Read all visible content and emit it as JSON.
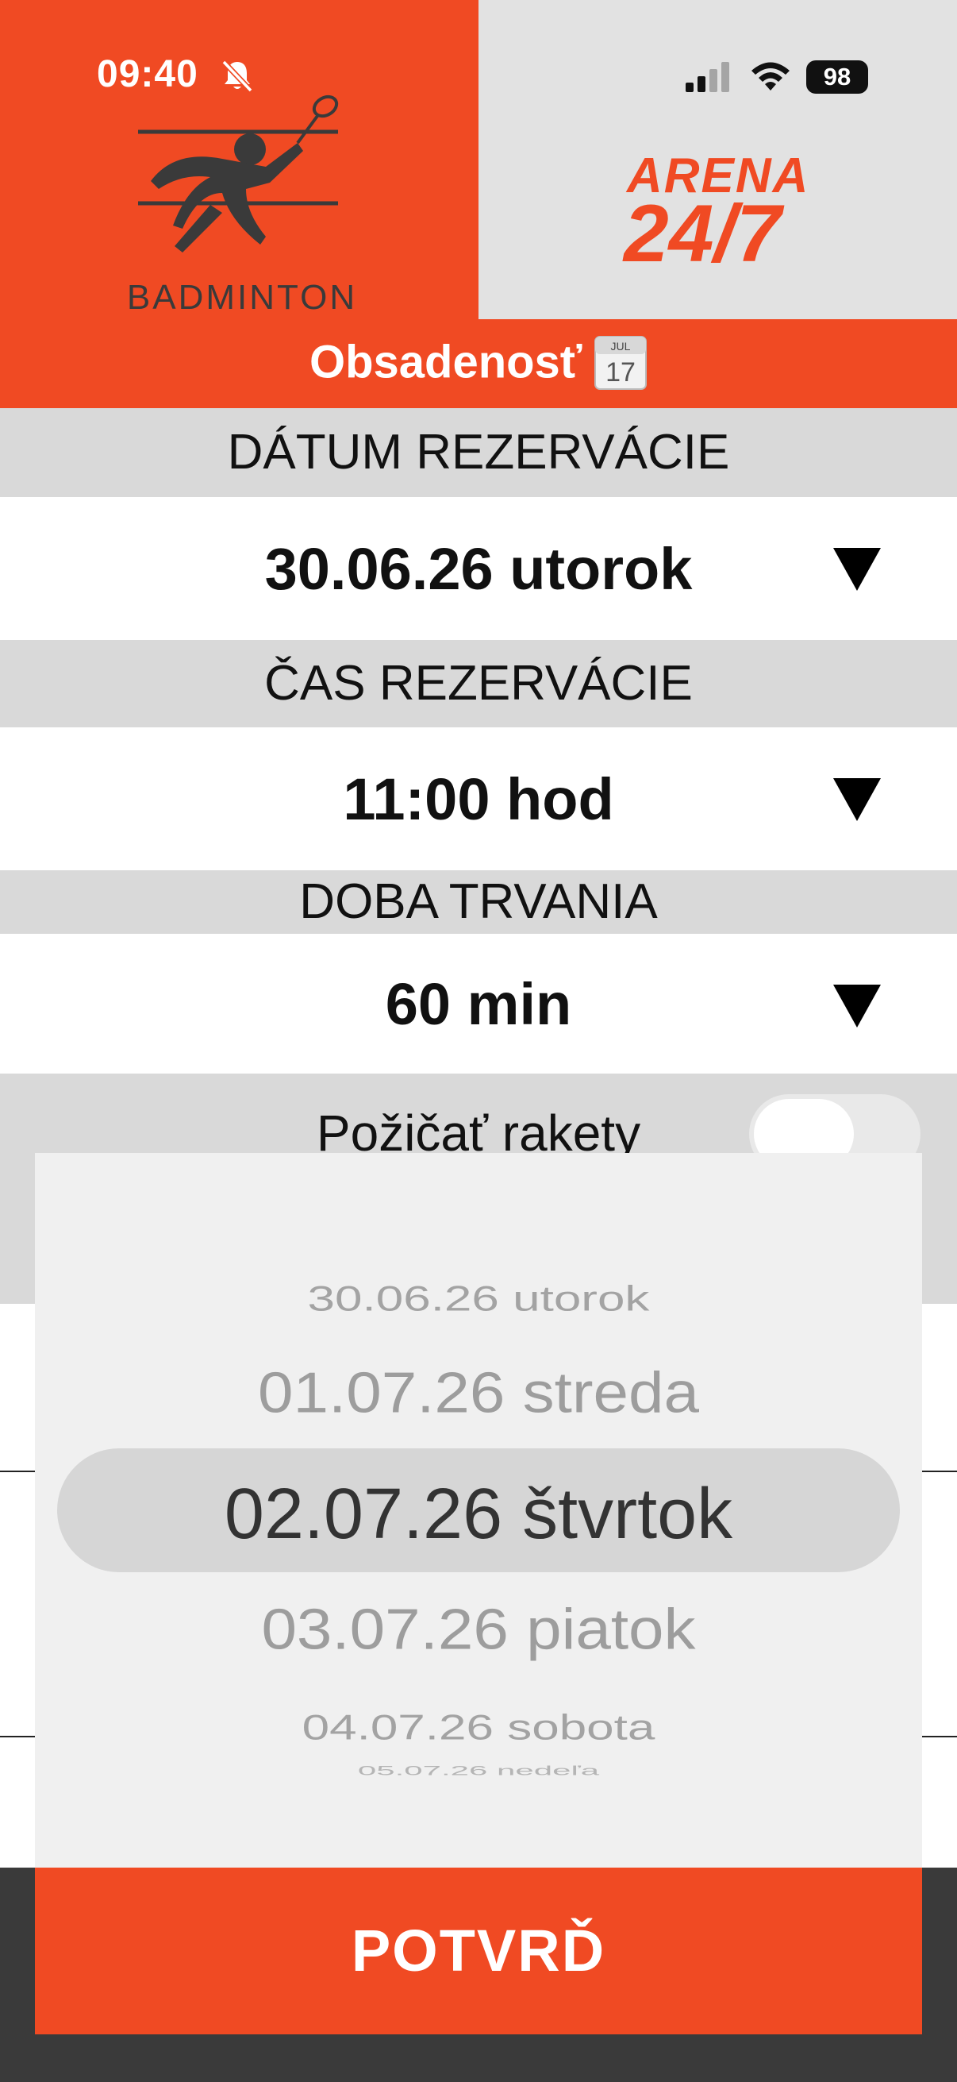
{
  "status_bar": {
    "time": "09:40",
    "battery": "98"
  },
  "header": {
    "logo_text": "BADMINTON",
    "brand_word": "ARENA",
    "brand_number": "24/7",
    "title": "Obsadenosť",
    "calendar_month": "JUL",
    "calendar_day": "17"
  },
  "form": {
    "date_label": "DÁTUM REZERVÁCIE",
    "date_value": "30.06.26 utorok",
    "time_label": "ČAS REZERVÁCIE",
    "time_value": "11:00 hod",
    "duration_label": "DOBA TRVANIA",
    "duration_value": "60 min",
    "rackets_label": "Požičať rakety",
    "rackets_on": false
  },
  "picker": {
    "options": [
      "30.06.26 utorok",
      "01.07.26 streda",
      "02.07.26 štvrtok",
      "03.07.26 piatok",
      "04.07.26 sobota",
      "05.07.26 nedeľa"
    ],
    "selected_index": 2
  },
  "confirm_button": "POTVRĎ",
  "colors": {
    "brand": "#f04a23",
    "header_gray": "#e2e2e2",
    "section_gray": "#d9d9d9"
  }
}
